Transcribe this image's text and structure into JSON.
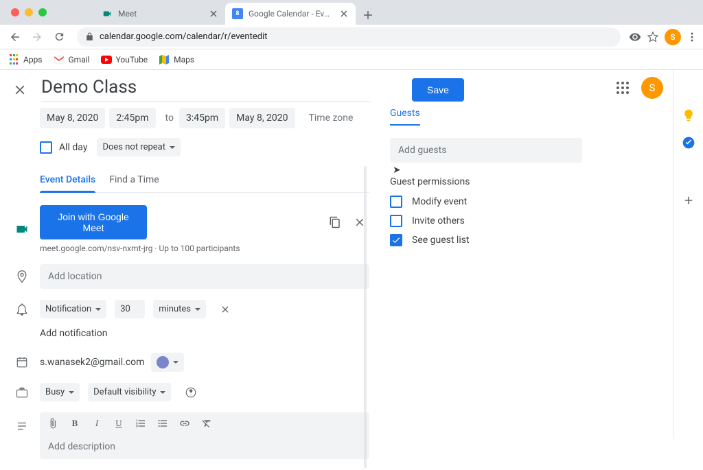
{
  "browser": {
    "tabs": [
      {
        "title": "Meet",
        "icon": "meet"
      },
      {
        "title": "Google Calendar - Event detail",
        "icon": "calendar"
      }
    ],
    "url": "calendar.google.com/calendar/r/eventedit",
    "bookmarks": [
      {
        "label": "Apps",
        "icon": "apps"
      },
      {
        "label": "Gmail",
        "icon": "gmail"
      },
      {
        "label": "YouTube",
        "icon": "youtube"
      },
      {
        "label": "Maps",
        "icon": "maps"
      }
    ],
    "avatar_letter": "S"
  },
  "event": {
    "title": "Demo Class",
    "save": "Save",
    "date_start": "May 8, 2020",
    "time_start": "2:45pm",
    "time_to": "to",
    "time_end": "3:45pm",
    "date_end": "May 8, 2020",
    "timezone_label": "Time zone",
    "all_day": "All day",
    "repeat": "Does not repeat",
    "tabs": {
      "details": "Event Details",
      "find": "Find a Time"
    },
    "meet": {
      "join": "Join with Google Meet",
      "url": "meet.google.com/nsv-nxmt-jrg",
      "participants": "Up to 100 participants"
    },
    "location_ph": "Add location",
    "notification": {
      "type": "Notification",
      "value": "30",
      "unit": "minutes"
    },
    "add_notification": "Add notification",
    "calendar_email": "s.wanasek2@gmail.com",
    "busy": "Busy",
    "visibility": "Default visibility",
    "description_ph": "Add description"
  },
  "guests": {
    "header": "Guests",
    "add_ph": "Add guests",
    "permissions_label": "Guest permissions",
    "perm_modify": "Modify event",
    "perm_invite": "Invite others",
    "perm_see": "See guest list"
  }
}
